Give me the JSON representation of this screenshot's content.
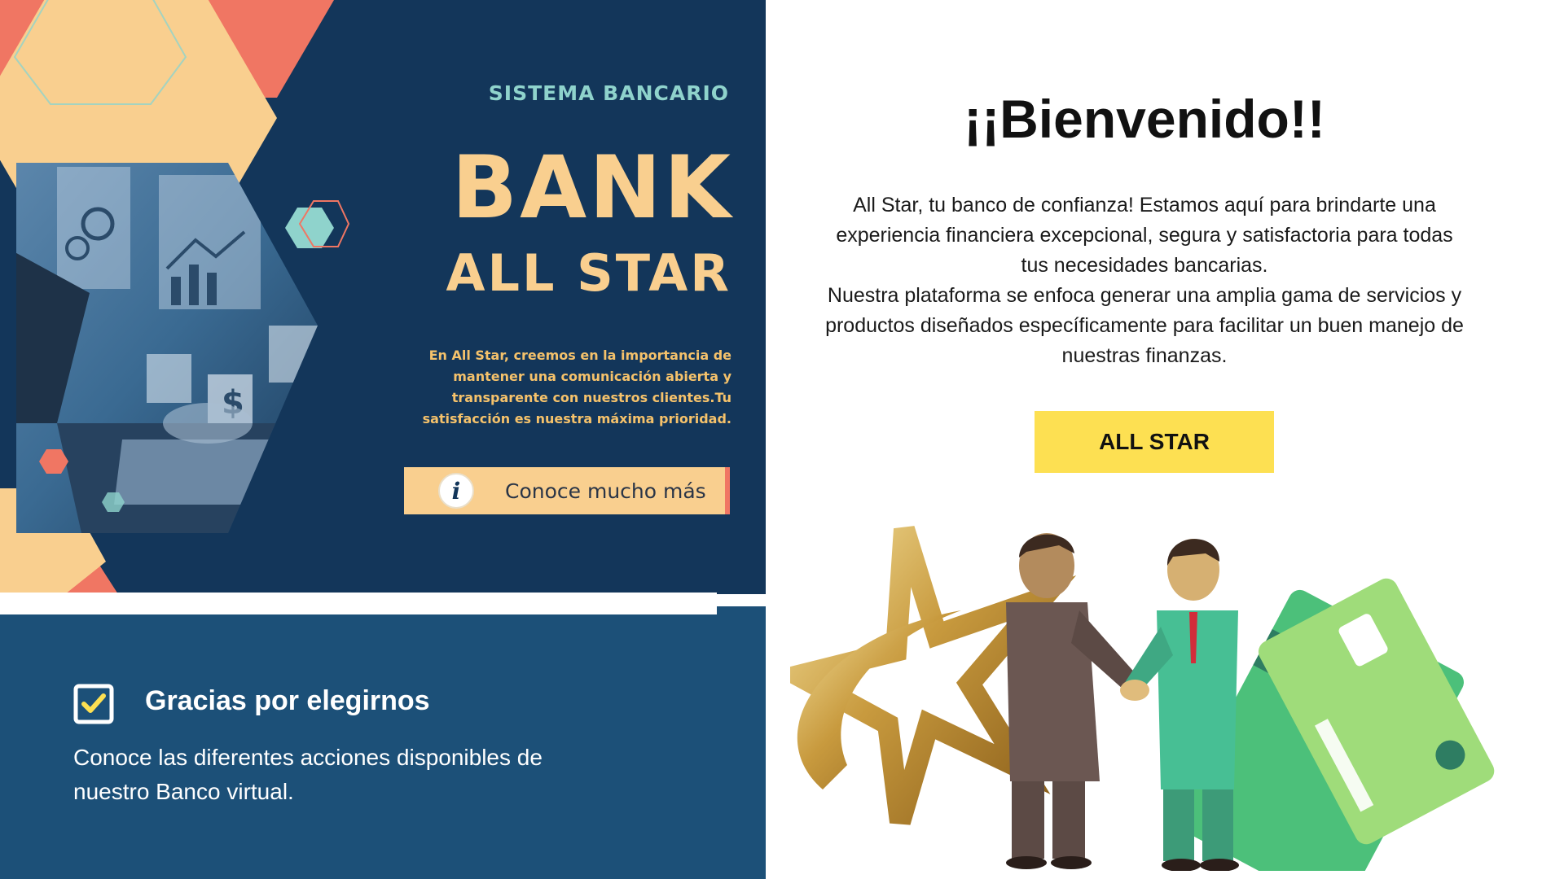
{
  "hero": {
    "subtitle": "SISTEMA BANCARIO",
    "title": "BANK",
    "title2": "ALL STAR",
    "text": "En All Star, creemos en la importancia de mantener una comunicación abierta y transparente con nuestros clientes.Tu satisfacción es nuestra máxima prioridad.",
    "cta_label": "Conoce mucho más",
    "cta_icon": "i"
  },
  "panel": {
    "title": "Gracias por elegirnos",
    "text": "Conoce las diferentes acciones disponibles de nuestro Banco virtual."
  },
  "welcome": {
    "title": "¡¡Bienvenido!!",
    "paragraph1": "All Star, tu banco de confianza! Estamos aquí para brindarte una experiencia financiera excepcional, segura y satisfactoria para todas tus necesidades bancarias.",
    "paragraph2": "Nuestra plataforma se enfoca generar una amplia gama de servicios y productos diseñados específicamente para facilitar un buen manejo de nuestras finanzas.",
    "button_label": "ALL STAR"
  },
  "colors": {
    "hero_bg": "#13365a",
    "panel_bg": "#1c5078",
    "accent_peach": "#f9cf8f",
    "accent_coral": "#f07663",
    "accent_teal": "#8fd3cc",
    "button_yellow": "#fde052"
  }
}
